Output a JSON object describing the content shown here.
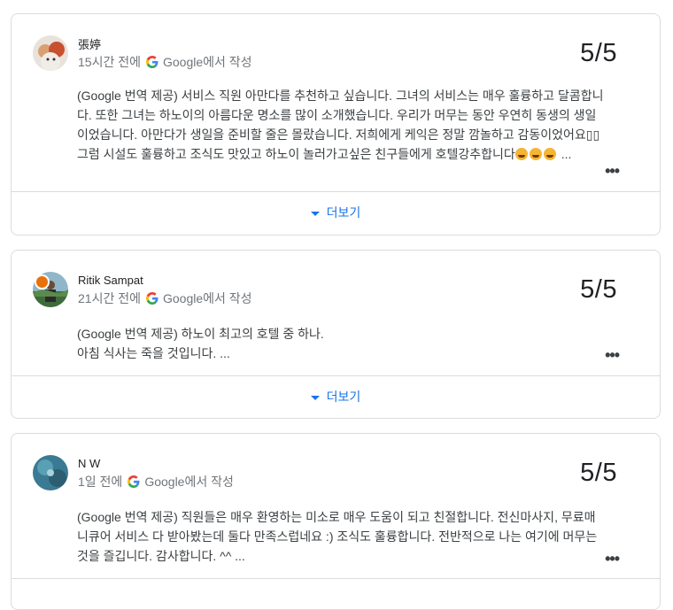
{
  "reviews": [
    {
      "name": "張婷",
      "time": "15시간 전에",
      "source": "Google에서 작성",
      "score": "5/5",
      "text": "(Google 번역 제공) 서비스 직원 아만다를 추천하고 싶습니다. 그녀의 서비스는 매우 훌륭하고 달콤합니다. 또한 그녀는 하노이의 아름다운 명소를 많이 소개했습니다. 우리가 머무는 동안 우연히 동생의 생일이었습니다. 아만다가 생일을 준비할 줄은 몰랐습니다. 저희에게 케익은 정말 깜놀하고 감동이었어요▯▯ 그럼 시설도 훌륭하고 조식도 맛있고 하노이 놀러가고싶은 친구들에게 호텔강추합니다",
      "text_tail": "...",
      "emoji_name": "grinning-squinting-face",
      "more_label": "더보기"
    },
    {
      "name": "Ritik Sampat",
      "time": "21시간 전에",
      "source": "Google에서 작성",
      "score": "5/5",
      "text_line1": "(Google 번역 제공) 하노이 최고의 호텔 중 하나.",
      "text_line2": "아침 식사는 죽을 것입니다. ...",
      "more_label": "더보기"
    },
    {
      "name": "N W",
      "time": "1일 전에",
      "source": "Google에서 작성",
      "score": "5/5",
      "text": "(Google 번역 제공) 직원들은 매우 환영하는 미소로 매우 도움이 되고 친절합니다. 전신마사지, 무료매니큐어 서비스 다 받아봤는데 둘다 만족스럽네요 :) 조식도 훌륭합니다. 전반적으로 나는 여기에 머무는 것을 즐깁니다. 감사합니다. ^^ ..."
    }
  ],
  "colors": {
    "link": "#1a73e8",
    "border": "#dadce0",
    "meta": "#70757a"
  }
}
